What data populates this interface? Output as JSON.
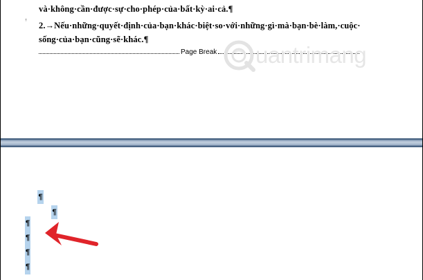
{
  "document": {
    "line_cut": "và không cần được sự cho phép của bất kỳ ai cả.",
    "lines": [
      "và·không·cần·được·sự·cho·phép·của·bất·kỳ·ai·cả.¶",
      "2.→Nếu·những·quyết·định·của·bạn·khác·biệt·so·với·những·gì·mà·bạn·bè·làm,·cuộc·",
      "sống·của·bạn·cũng·sẽ·khác.¶"
    ],
    "margin_mark": "ᵎ",
    "page_break_label": "Page Break",
    "pilcrow": "¶",
    "selected_paragraph_marks": [
      "¶",
      "¶",
      "¶",
      "¶"
    ]
  },
  "watermark": {
    "text": "uantrimang"
  },
  "colors": {
    "selection": "#b5d3ed",
    "page_gap": "#4a6584",
    "arrow": "#e0242a"
  }
}
